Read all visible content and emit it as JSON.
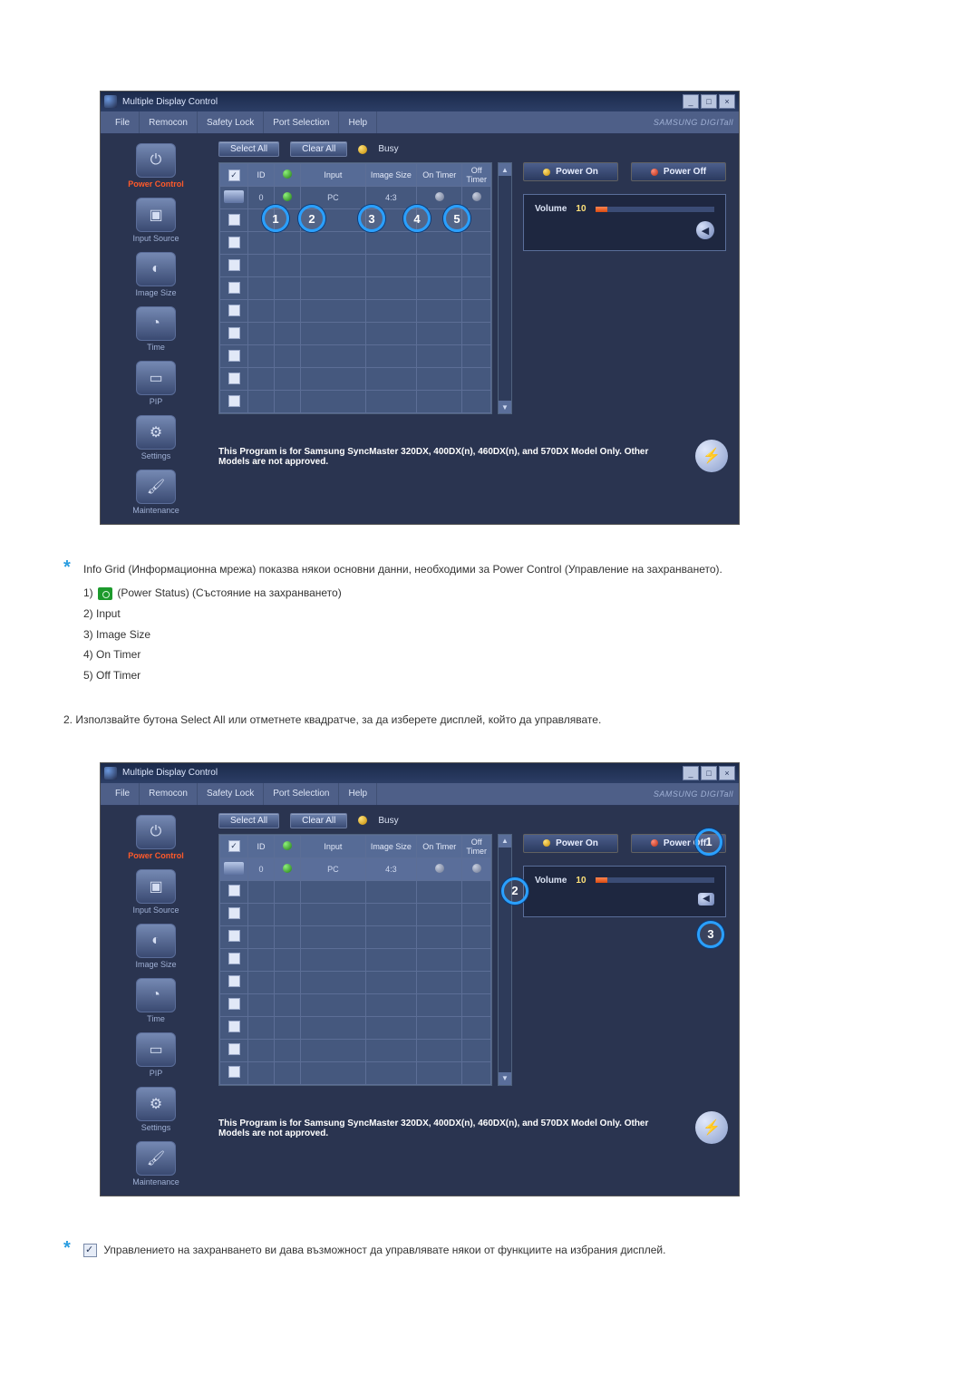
{
  "app": {
    "title": "Multiple Display Control",
    "brand": "SAMSUNG DIGITall",
    "menu": [
      "File",
      "Remocon",
      "Safety Lock",
      "Port Selection",
      "Help"
    ],
    "toolbar": {
      "select_all": "Select All",
      "clear_all": "Clear All",
      "busy": "Busy"
    },
    "sidebar": [
      {
        "label": "Power Control"
      },
      {
        "label": "Input Source"
      },
      {
        "label": "Image Size"
      },
      {
        "label": "Time"
      },
      {
        "label": "PIP"
      },
      {
        "label": "Settings"
      },
      {
        "label": "Maintenance"
      }
    ],
    "grid": {
      "headers": {
        "chk": "",
        "id": "ID",
        "pwr": "",
        "input": "Input",
        "image_size": "Image Size",
        "on_timer": "On Timer",
        "off_timer": "Off Timer"
      },
      "row0": {
        "id": "0",
        "input": "PC",
        "image_size": "4:3"
      }
    },
    "right": {
      "power_on": "Power On",
      "power_off": "Power Off",
      "volume_label": "Volume",
      "volume_value": "10"
    },
    "disclaimer": "This Program is for Samsung SyncMaster 320DX, 400DX(n), 460DX(n), and 570DX  Model Only. Other Models are not approved."
  },
  "text": {
    "note1": "Info Grid (Информационна мрежа) показва някои основни данни, необходими за Power Control (Управление на захранването).",
    "list1_1_a": "1) ",
    "list1_1_b": " (Power Status) (Състояние на захранването)",
    "list1_2": "2) Input",
    "list1_3": "3) Image Size",
    "list1_4": "4) On Timer",
    "list1_5": "5) Off Timer",
    "step2": "2.  Използвайте бутона Select All или отметнете квадратче, за да изберете дисплей, който да управлявате.",
    "note2": " Управлението на захранването ви дава възможност да управлявате някои от функциите на избрания дисплей."
  },
  "callouts": {
    "img1": {
      "c1": "1",
      "c2": "2",
      "c3": "3",
      "c4": "4",
      "c5": "5"
    },
    "img2": {
      "c1": "1",
      "c2": "2",
      "c3": "3"
    }
  }
}
